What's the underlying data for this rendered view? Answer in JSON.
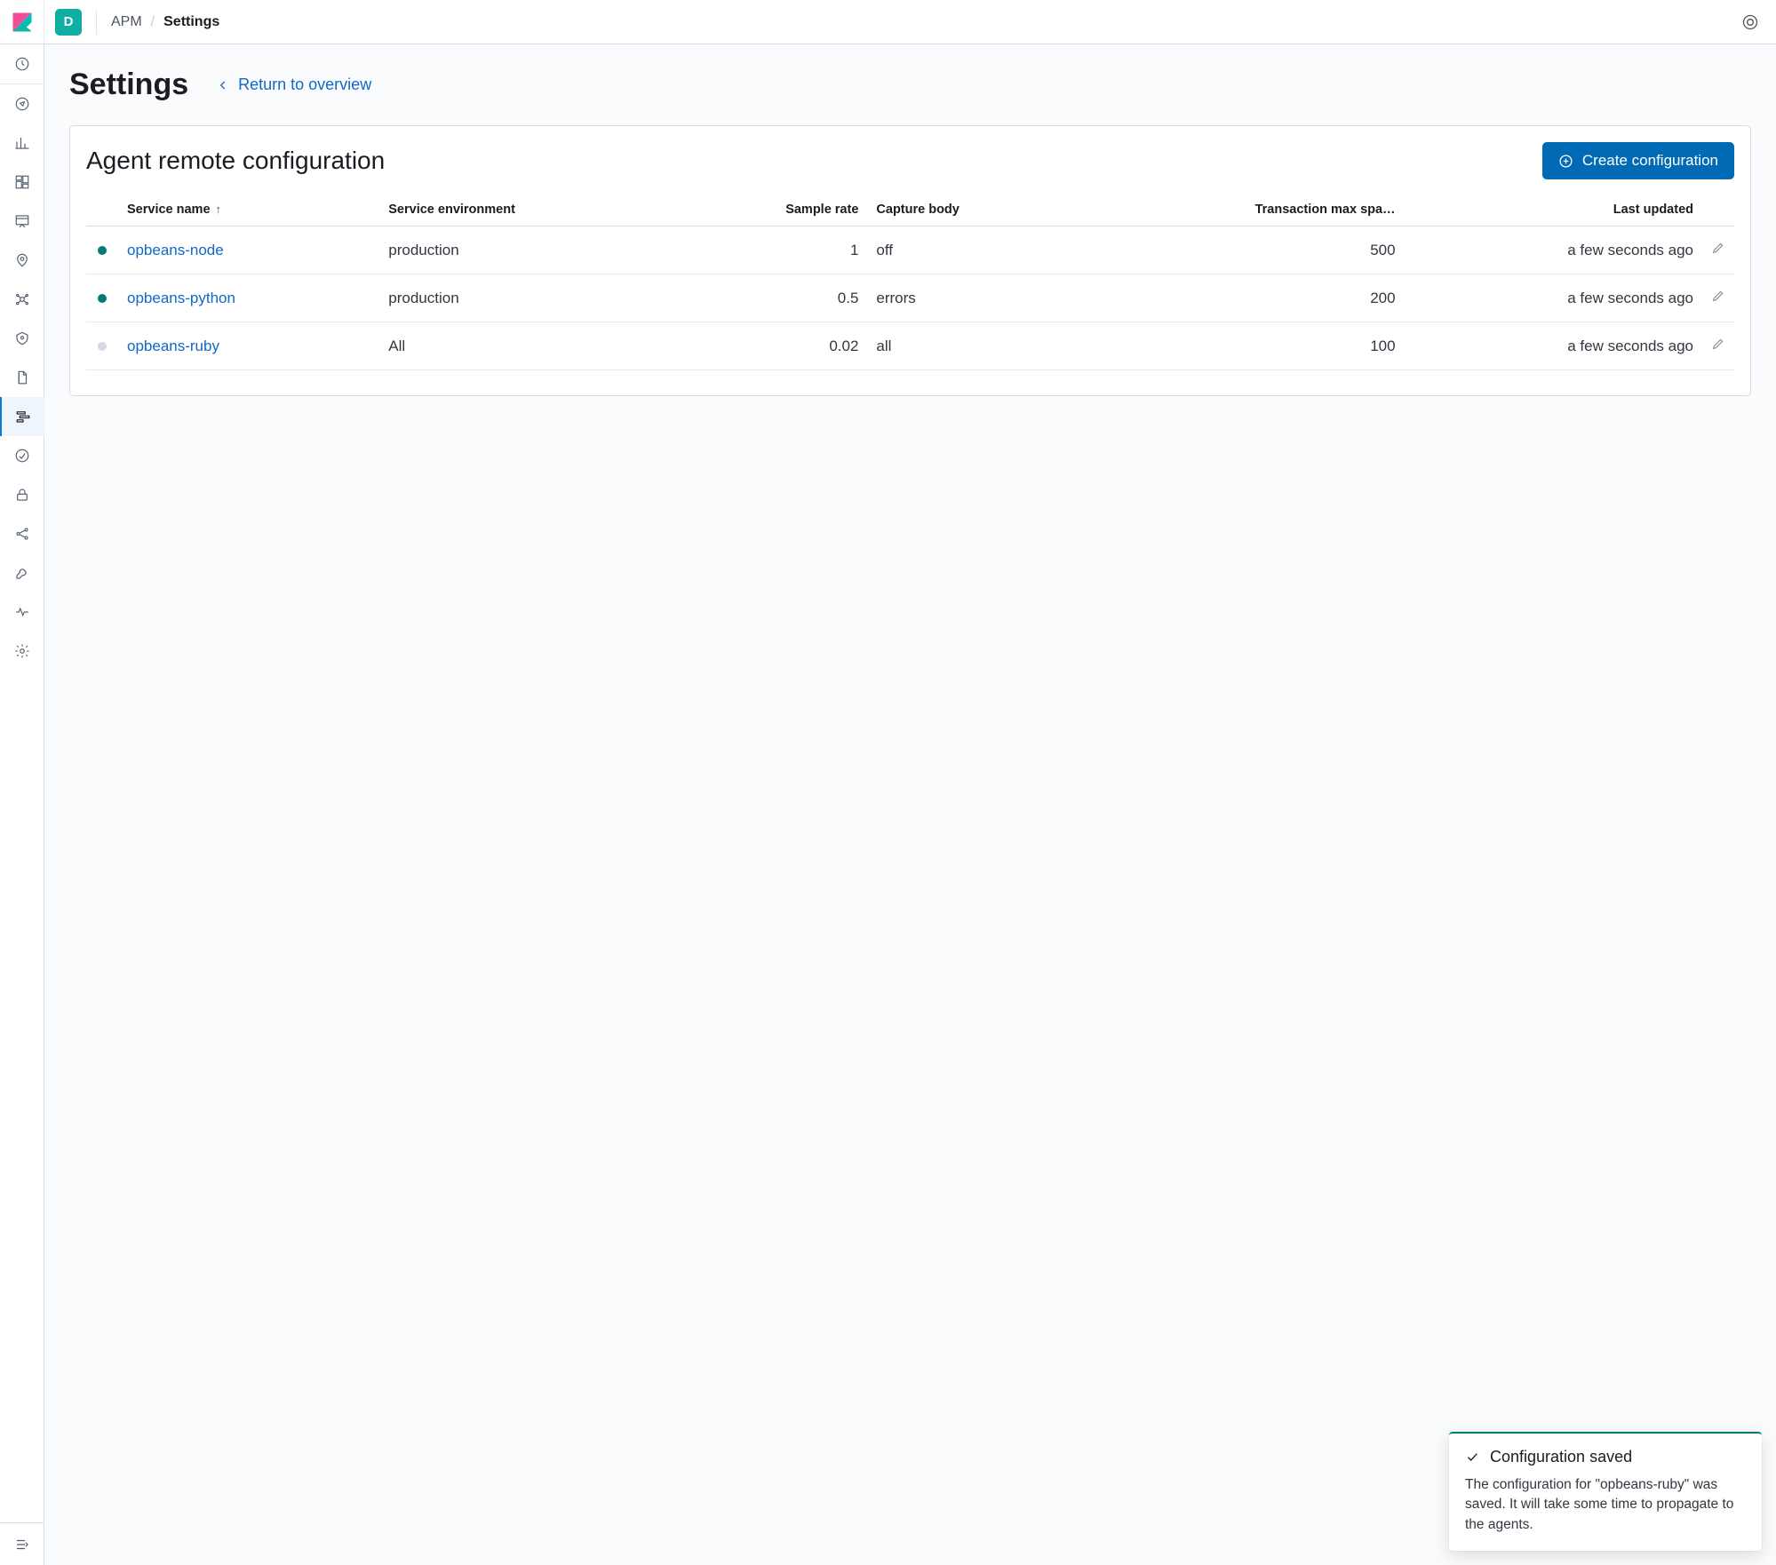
{
  "header": {
    "space_initial": "D",
    "breadcrumbs": {
      "root": "APM",
      "current": "Settings"
    }
  },
  "sidenav": {
    "items": [
      {
        "name": "recent-icon"
      },
      {
        "name": "discover-icon"
      },
      {
        "name": "visualize-icon"
      },
      {
        "name": "dashboard-icon"
      },
      {
        "name": "canvas-icon"
      },
      {
        "name": "maps-icon"
      },
      {
        "name": "ml-icon"
      },
      {
        "name": "infra-icon"
      },
      {
        "name": "logs-icon"
      },
      {
        "name": "apm-icon",
        "active": true
      },
      {
        "name": "uptime-icon"
      },
      {
        "name": "siem-icon"
      },
      {
        "name": "graph-icon"
      },
      {
        "name": "devtools-icon"
      },
      {
        "name": "monitoring-icon"
      },
      {
        "name": "management-icon"
      }
    ]
  },
  "page": {
    "title": "Settings",
    "return_label": "Return to overview"
  },
  "panel": {
    "title": "Agent remote configuration",
    "create_button": "Create configuration",
    "columns": {
      "service_name": "Service name",
      "service_env": "Service environment",
      "sample_rate": "Sample rate",
      "capture_body": "Capture body",
      "max_spans": "Transaction max spa…",
      "last_updated": "Last updated"
    },
    "rows": [
      {
        "status": "on",
        "name": "opbeans-node",
        "env": "production",
        "sample_rate": "1",
        "capture_body": "off",
        "max_spans": "500",
        "updated": "a few seconds ago"
      },
      {
        "status": "on",
        "name": "opbeans-python",
        "env": "production",
        "sample_rate": "0.5",
        "capture_body": "errors",
        "max_spans": "200",
        "updated": "a few seconds ago"
      },
      {
        "status": "off",
        "name": "opbeans-ruby",
        "env": "All",
        "sample_rate": "0.02",
        "capture_body": "all",
        "max_spans": "100",
        "updated": "a few seconds ago"
      }
    ]
  },
  "toast": {
    "title": "Configuration saved",
    "body": "The configuration for \"opbeans-ruby\" was saved. It will take some time to propagate to the agents."
  }
}
